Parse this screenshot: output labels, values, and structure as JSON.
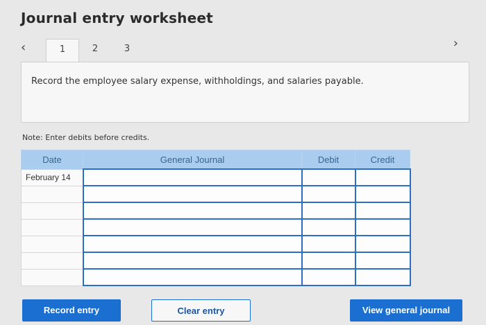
{
  "title": "Journal entry worksheet",
  "nav": {
    "prev_glyph": "‹",
    "next_glyph": "›"
  },
  "tabs": [
    {
      "label": "1"
    },
    {
      "label": "2"
    },
    {
      "label": "3"
    }
  ],
  "instruction": "Record the employee salary expense, withholdings, and salaries payable.",
  "note": "Note: Enter debits before credits.",
  "table": {
    "headers": {
      "date": "Date",
      "journal": "General Journal",
      "debit": "Debit",
      "credit": "Credit"
    },
    "rows": [
      {
        "date": "February 14"
      },
      {
        "date": ""
      },
      {
        "date": ""
      },
      {
        "date": ""
      },
      {
        "date": ""
      },
      {
        "date": ""
      },
      {
        "date": ""
      }
    ]
  },
  "buttons": {
    "record": "Record entry",
    "clear": "Clear entry",
    "view": "View general journal"
  },
  "colors": {
    "header_bg": "#aaccee",
    "header_text": "#39658e",
    "primary": "#1b6fd1",
    "input_border": "#2a6fc4"
  }
}
